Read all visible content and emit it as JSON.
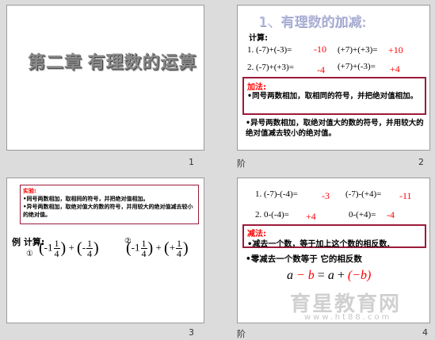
{
  "slides": [
    {
      "number": "1",
      "title": "第二章   有理数的运算"
    },
    {
      "number": "2",
      "title": "1、有理数的加减:",
      "compute_label": "计算:",
      "rows": [
        {
          "idx": "1.",
          "q1": "(-7)+(-3)=",
          "a1": "-10",
          "q2": "(+7)+(+3)=",
          "a2": "+10"
        },
        {
          "idx": "2.",
          "q1": "(-7)+(+3)=",
          "a1": "-4",
          "q2": "(+7)+(-3)=",
          "a2": "+4"
        }
      ],
      "rule_head": "加法:",
      "rule_1": "•同号两数相加，取相同的符号，并把绝对值相加。",
      "rule_2": "•异号两数相加，取绝对值大的数的符号，并用较大的绝对值减去较小的绝对值。",
      "footer_left": "阶"
    },
    {
      "number": "3",
      "box_head": "实验:",
      "box_line1": "•同号两数相加，取相同的符号，并把绝对值相加。",
      "box_line2": "•异号两数相加，取绝对值大的数的符号，并用较大的绝对值减去较小的绝对值。",
      "example_label": "例  计算:",
      "ex1_mark": "①",
      "ex2_mark": "②",
      "one": "1",
      "four": "4",
      "minus_one": "-1",
      "minus": "-",
      "plus": "+",
      "plus_sign": "+"
    },
    {
      "number": "4",
      "rows": [
        {
          "idx": "1.",
          "q1": "(-7)-(-4)=",
          "a1": "-3",
          "q2": "(-7)-(+4)=",
          "a2": "-11"
        },
        {
          "idx": "2.",
          "q1": "0-(-4)=",
          "a1": "+4",
          "q2": "0-(+4)=",
          "a2": "-4"
        }
      ],
      "rule_head": "减法:",
      "rule_1": "•减去一个数，等于加上这个数的相反数.",
      "rule_2": "•零减去一个数等于 它的相反数",
      "formula_a": "a",
      "formula_minus": "−",
      "formula_b": "b",
      "formula_eq": "=",
      "formula_a2": "a",
      "formula_plus": "+",
      "formula_neg_b": "(−b)",
      "footer_left": "阶",
      "watermark": "育星教育网",
      "watermark_url": "www.ht88.com"
    }
  ],
  "colors": {
    "accent_red": "#ff0000",
    "box_border": "#9b1b3a",
    "title_blue": "#b9bfe0"
  }
}
